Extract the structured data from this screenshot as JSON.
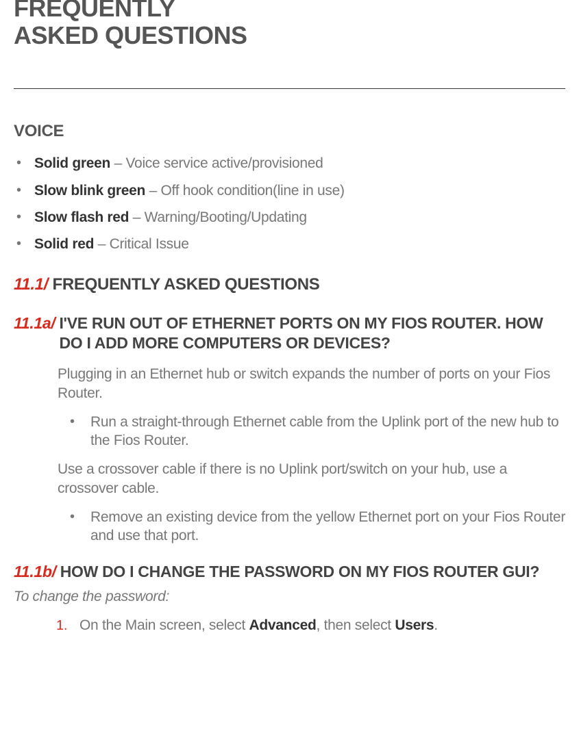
{
  "title_line1": "FREQUENTLY",
  "title_line2": "ASKED QUESTIONS",
  "voice": {
    "heading": "VOICE",
    "items": [
      {
        "label": "Solid green",
        "desc": " – Voice service active/provisioned"
      },
      {
        "label": "Slow blink green",
        "desc": " – Off hook condition(line in use)"
      },
      {
        "label": "Slow flash red",
        "desc": " – Warning/Booting/Updating"
      },
      {
        "label": "Solid red",
        "desc": " – Critical Issue"
      }
    ]
  },
  "faq": {
    "section_num": "11.1/",
    "section_title": " FREQUENTLY ASKED QUESTIONS",
    "q1": {
      "num": "11.1a/",
      "heading": " I'VE RUN OUT OF ETHERNET PORTS ON MY FIOS ROUTER. HOW DO I ADD MORE COMPUTERS OR DEVICES?",
      "p1": "Plugging in an Ethernet hub or switch expands the number of ports on your Fios Router.",
      "b1": "Run a straight-through Ethernet cable from the Uplink port of the new hub to the Fios Router.",
      "p2": "Use a crossover cable if there is no Uplink port/switch on your hub, use a crossover cable.",
      "b2": "Remove an existing device from the yellow Ethernet port on your Fios Router and use that port."
    },
    "q2": {
      "num": "11.1b/",
      "heading": " HOW DO I CHANGE THE PASSWORD ON MY FIOS ROUTER GUI?",
      "lead": "To change the password:",
      "step1_num": "1.",
      "step1_pre": "On the Main screen, select ",
      "step1_bold1": "Advanced",
      "step1_mid": ", then select ",
      "step1_bold2": "Users",
      "step1_end": "."
    }
  }
}
